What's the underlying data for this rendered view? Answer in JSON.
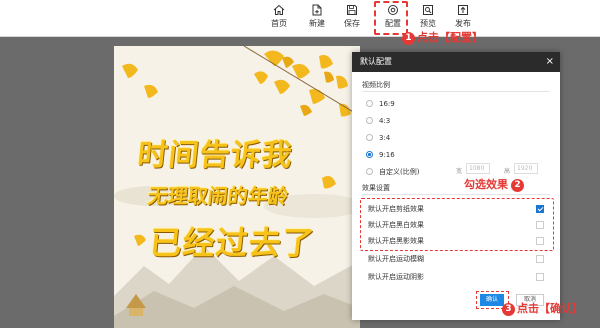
{
  "toolbar": {
    "items": [
      {
        "label": "首页",
        "icon": "home-icon"
      },
      {
        "label": "新建",
        "icon": "new-file-icon"
      },
      {
        "label": "保存",
        "icon": "save-icon"
      },
      {
        "label": "配置",
        "icon": "config-icon"
      },
      {
        "label": "预览",
        "icon": "preview-icon"
      },
      {
        "label": "发布",
        "icon": "publish-icon"
      }
    ]
  },
  "annotations": {
    "step1": {
      "num": "1",
      "text": "点击【配置】"
    },
    "step2": {
      "num": "2",
      "text": "勾选效果"
    },
    "step3": {
      "num": "3",
      "text": "点击【确认】"
    },
    "color": "#e53935"
  },
  "poster": {
    "line1": "时间告诉我",
    "line2": "无理取闹的年龄",
    "line3": "已经过去了"
  },
  "dialog": {
    "title": "默认配置",
    "close": "×",
    "ratio_section": "视频比例",
    "ratios": [
      "16:9",
      "4:3",
      "3:4",
      "9:16",
      "自定义(比例)"
    ],
    "selected_ratio": "9:16",
    "width_label": "宽",
    "width_value": "1080",
    "height_label": "高",
    "height_value": "1920",
    "effects_section": "效果设置",
    "effects": [
      {
        "label": "默认开启剪纸效果",
        "checked": true
      },
      {
        "label": "默认开启黑白效果",
        "checked": false
      },
      {
        "label": "默认开启黑影效果",
        "checked": false
      },
      {
        "label": "默认开启运动模糊",
        "checked": false
      },
      {
        "label": "默认开启运动阴影",
        "checked": false
      }
    ],
    "ok_label": "确认",
    "cancel_label": "取消"
  },
  "colors": {
    "accent": "#1e88e5",
    "poster_text": "#f7c21a",
    "canvas_bg": "#6b6b6b"
  }
}
